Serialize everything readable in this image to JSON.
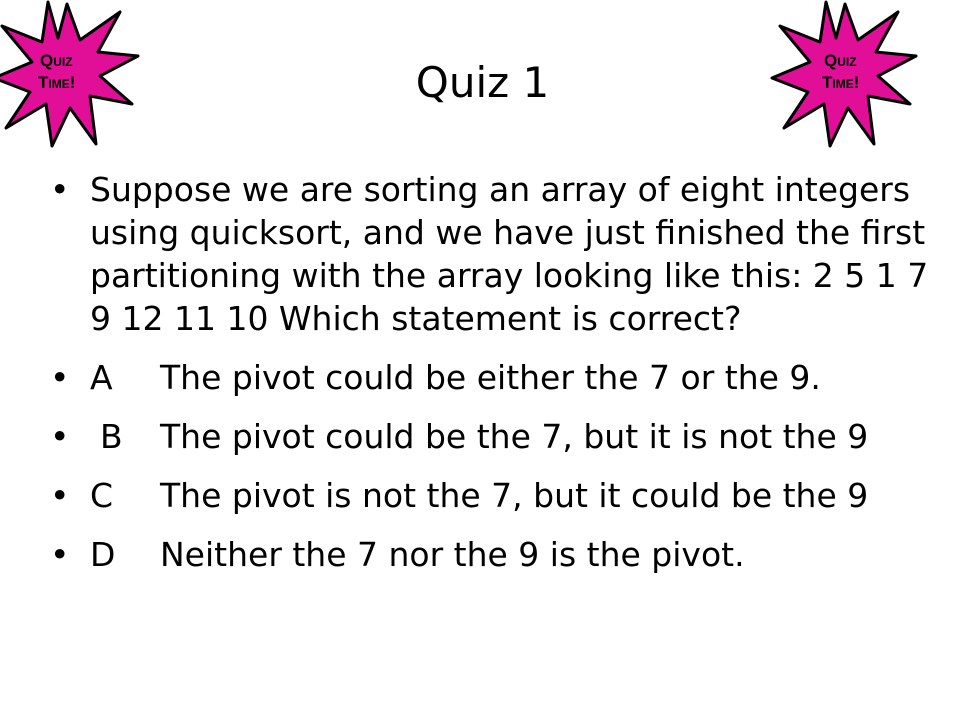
{
  "slide": {
    "title": "Quiz 1",
    "badge": {
      "line1": "Quiz",
      "line2": "Time!",
      "color": "#e10f98",
      "outline": "#000000"
    },
    "bullet_symbol": "•",
    "question": "Suppose we are sorting an array of eight integers using quicksort, and we have just finished the first partitioning with the array looking like this: 2 5 1 7 9 12 11 10 Which statement is correct?",
    "options": [
      {
        "letter": "A",
        "text": "The pivot could be either the 7 or the 9."
      },
      {
        "letter": "B",
        "text": "The pivot could be the 7, but it is not the 9"
      },
      {
        "letter": "C",
        "text": "The pivot is not the 7, but it could be the 9"
      },
      {
        "letter": "D",
        "text": "Neither the 7 nor the 9 is the pivot."
      }
    ]
  }
}
